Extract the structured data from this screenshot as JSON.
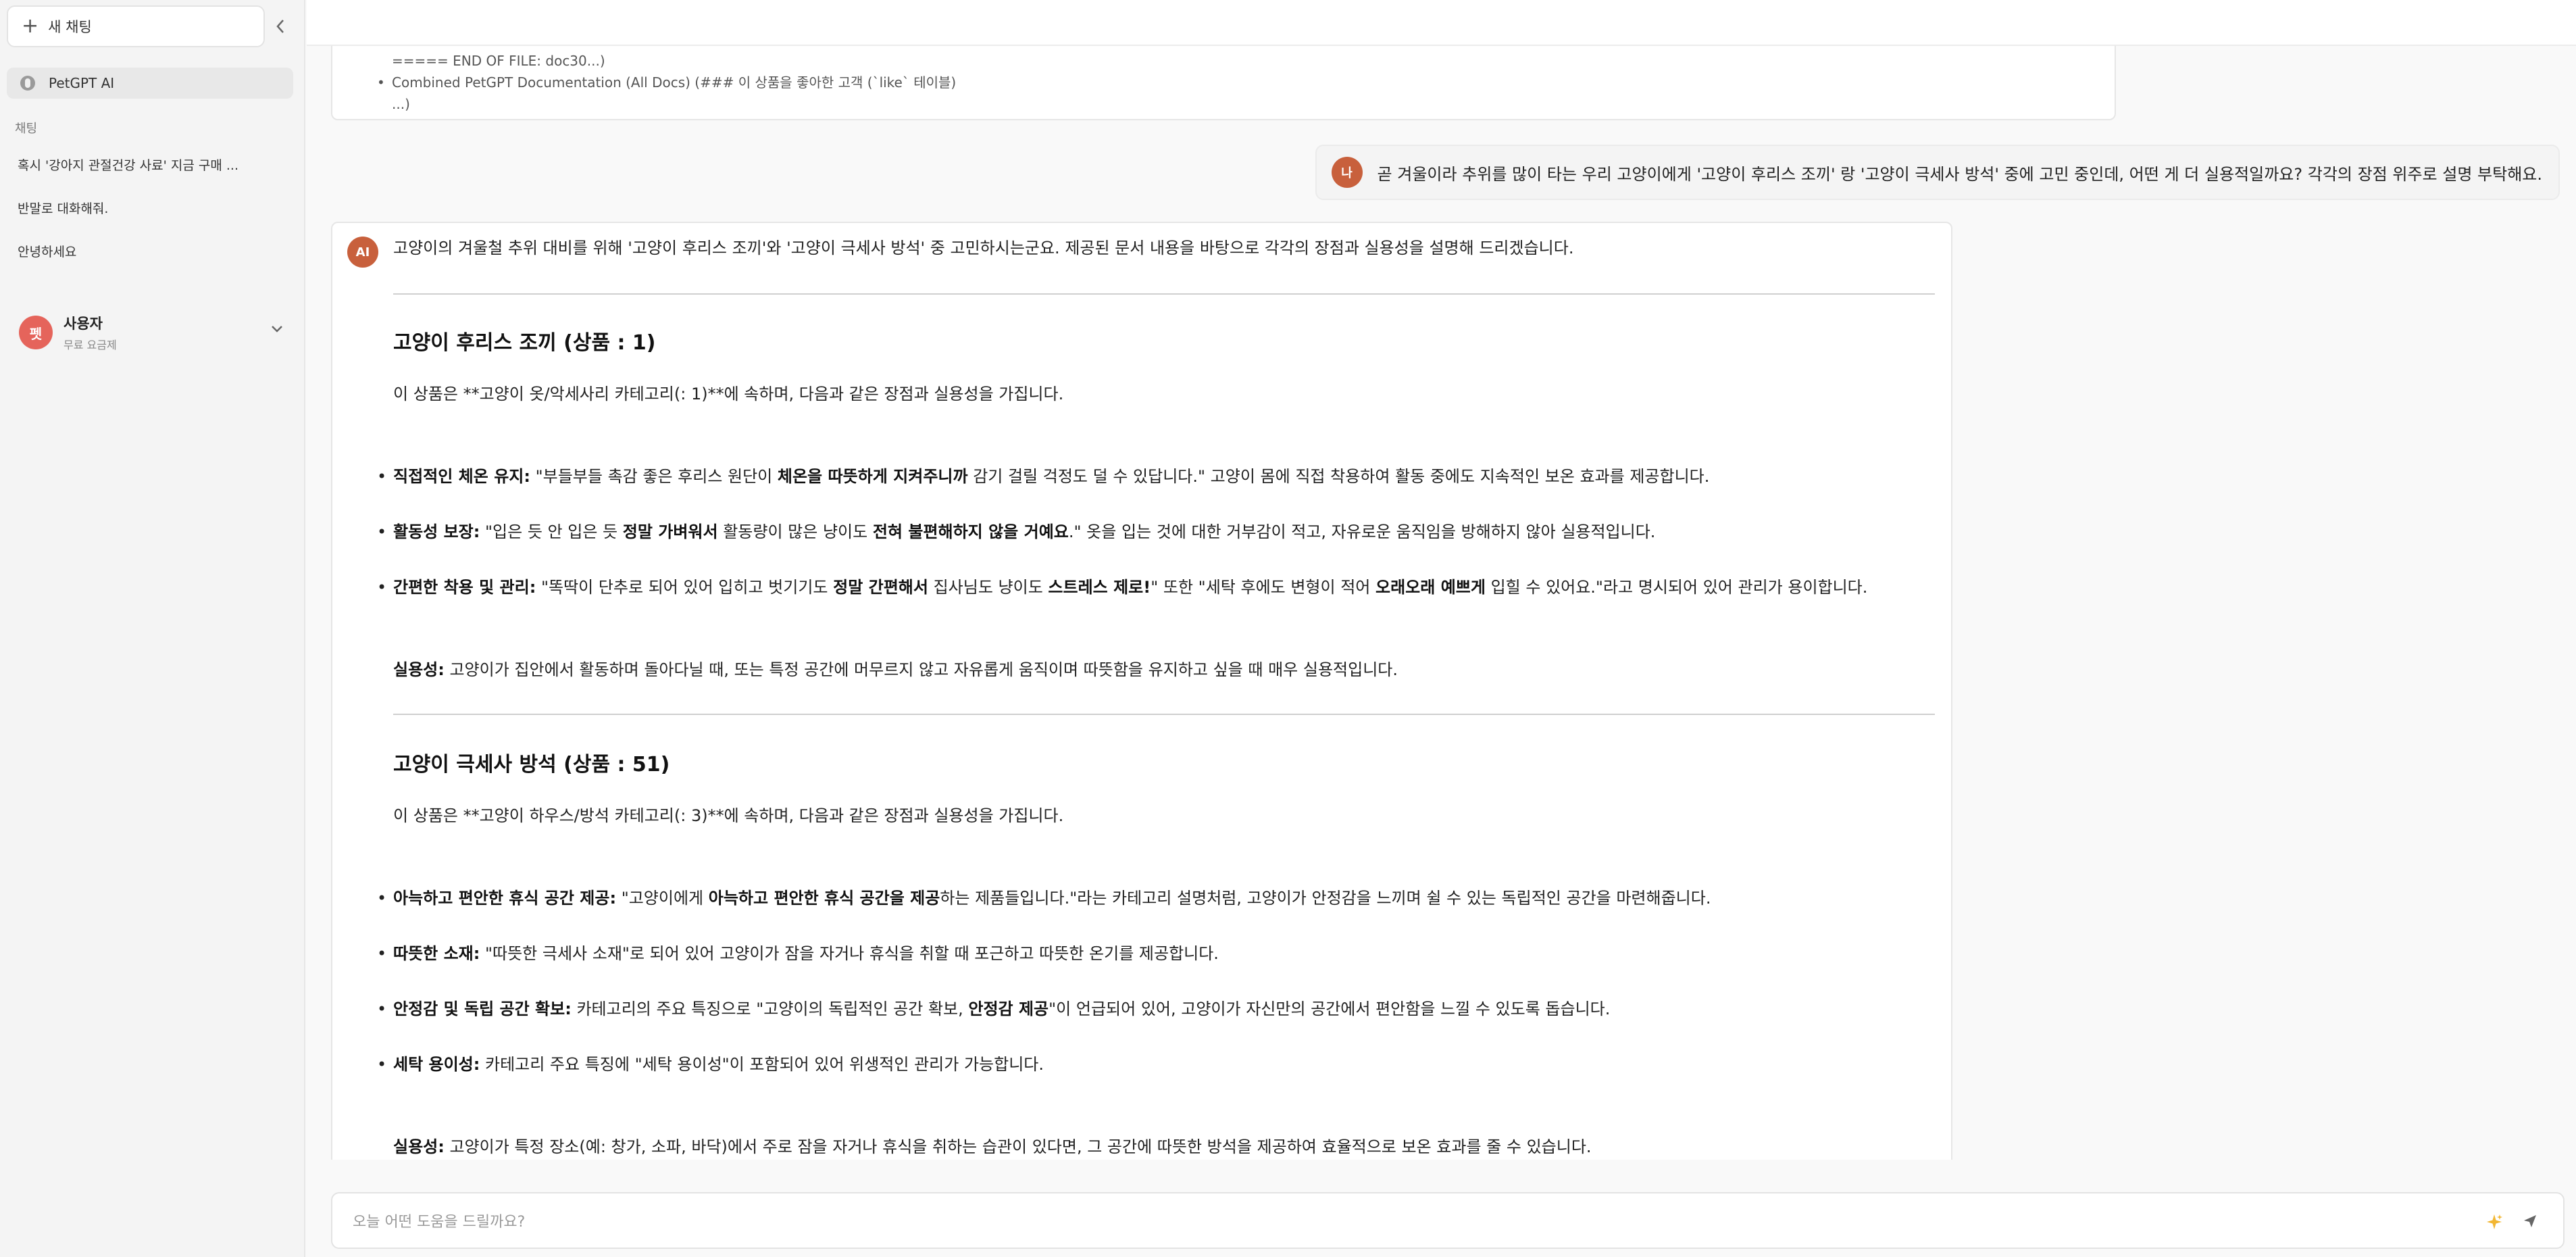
{
  "sidebar": {
    "new_chat_label": "새 채팅",
    "model_label": "PetGPT AI",
    "section_label": "채팅",
    "items": [
      {
        "label": "혹시 '강아지 관절건강 사료' 지금 구매 ..."
      },
      {
        "label": "반말로 대화해줘."
      },
      {
        "label": "안녕하세요"
      }
    ],
    "user": {
      "avatar": "펫",
      "name": "사용자",
      "plan": "무료 요금제"
    }
  },
  "previous_card": {
    "line1": "===== END OF FILE: doc30...)",
    "line2": "Combined PetGPT Documentation (All Docs) (### 이 상품을 좋아한 고객 (`like` 테이블)",
    "line3": "...)"
  },
  "user_message": {
    "avatar": "나",
    "text": "곧 겨울이라 추위를 많이 타는 우리 고양이에게 '고양이 후리스 조끼' 랑 '고양이 극세사 방석' 중에 고민 중인데, 어떤 게 더 실용적일까요? 각각의 장점 위주로 설명 부탁해요."
  },
  "ai_message": {
    "avatar": "AI",
    "intro": "고양이의 겨울철 추위 대비를 위해 '고양이 후리스 조끼'와 '고양이 극세사 방석' 중 고민하시는군요. 제공된 문서 내용을 바탕으로 각각의 장점과 실용성을 설명해 드리겠습니다.",
    "section1": {
      "title": "고양이 후리스 조끼 (상품 : 1)",
      "desc": "이 상품은 **고양이 옷/악세사리 카테고리(: 1)**에 속하며, 다음과 같은 장점과 실용성을 가집니다.",
      "b1_label": "직접적인 체온 유지:",
      "b1_t1": " \"부들부들 촉감 좋은 후리스 원단이 ",
      "b1_bold": "체온을 따뜻하게 지켜주니까",
      "b1_t2": " 감기 걸릴 걱정도 덜 수 있답니다.\" 고양이 몸에 직접 착용하여 활동 중에도 지속적인 보온 효과를 제공합니다.",
      "b2_label": "활동성 보장:",
      "b2_t1": " \"입은 듯 안 입은 듯 ",
      "b2_bold1": "정말 가벼워서",
      "b2_t2": " 활동량이 많은 냥이도 ",
      "b2_bold2": "전혀 불편해하지 않을 거예요",
      "b2_t3": ".\" 옷을 입는 것에 대한 거부감이 적고, 자유로운 움직임을 방해하지 않아 실용적입니다.",
      "b3_label": "간편한 착용 및 관리:",
      "b3_t1": " \"똑딱이 단추로 되어 있어 입히고 벗기기도 ",
      "b3_bold1": "정말 간편해서",
      "b3_t2": " 집사님도 냥이도 ",
      "b3_bold2": "스트레스 제로!",
      "b3_t3": "\" 또한 \"세탁 후에도 변형이 적어 ",
      "b3_bold3": "오래오래 예쁘게",
      "b3_t4": " 입힐 수 있어요.\"라고 명시되어 있어 관리가 용이합니다.",
      "practical_label": "실용성:",
      "practical_text": " 고양이가 집안에서 활동하며 돌아다닐 때, 또는 특정 공간에 머무르지 않고 자유롭게 움직이며 따뜻함을 유지하고 싶을 때 매우 실용적입니다."
    },
    "section2": {
      "title": "고양이 극세사 방석 (상품 : 51)",
      "desc": "이 상품은 **고양이 하우스/방석 카테고리(: 3)**에 속하며, 다음과 같은 장점과 실용성을 가집니다.",
      "b1_label": "아늑하고 편안한 휴식 공간 제공:",
      "b1_t1": " \"고양이에게 ",
      "b1_bold": "아늑하고 편안한 휴식 공간을 제공",
      "b1_t2": "하는 제품들입니다.\"라는 카테고리 설명처럼, 고양이가 안정감을 느끼며 쉴 수 있는 독립적인 공간을 마련해줍니다.",
      "b2_label": "따뜻한 소재:",
      "b2_t1": " \"따뜻한 극세사 소재\"로 되어 있어 고양이가 잠을 자거나 휴식을 취할 때 포근하고 따뜻한 온기를 제공합니다.",
      "b3_label": "안정감 및 독립 공간 확보:",
      "b3_t1": " 카테고리의 주요 특징으로 \"고양이의 독립적인 공간 확보, ",
      "b3_bold": "안정감 제공",
      "b3_t2": "\"이 언급되어 있어, 고양이가 자신만의 공간에서 편안함을 느낄 수 있도록 돕습니다.",
      "b4_label": "세탁 용이성:",
      "b4_t1": " 카테고리 주요 특징에 \"세탁 용이성\"이 포함되어 있어 위생적인 관리가 가능합니다.",
      "practical_label": "실용성:",
      "practical_text": " 고양이가 특정 장소(예: 창가, 소파, 바닥)에서 주로 잠을 자거나 휴식을 취하는 습관이 있다면, 그 공간에 따뜻한 방석을 제공하여 효율적으로 보온 효과를 줄 수 있습니다."
    }
  },
  "composer": {
    "placeholder": "오늘 어떤 도움을 드릴까요?",
    "value": ""
  },
  "icons": {
    "new_chat": "plus-icon",
    "collapse": "chevron-left-icon",
    "model": "model-icon",
    "user_menu": "chevron-down-icon",
    "sparkle": "sparkle-icon",
    "send": "send-icon"
  }
}
